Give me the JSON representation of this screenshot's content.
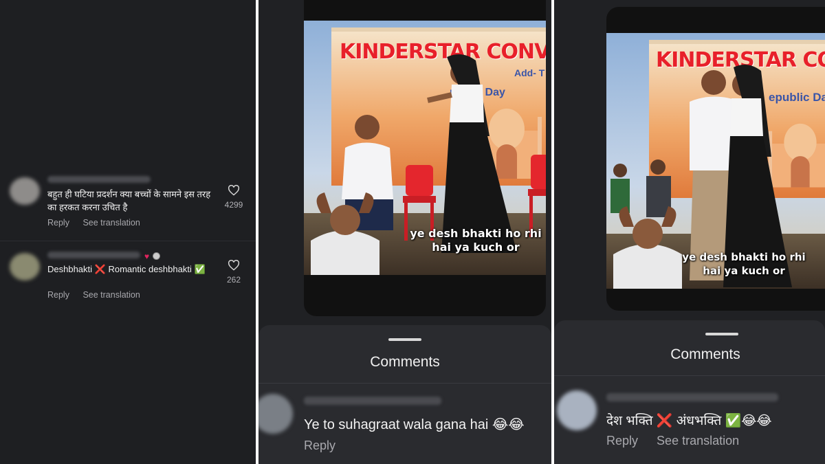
{
  "panel1": {
    "comments": [
      {
        "text": "बहुत ही घटिया प्रदर्शन क्या बच्चों के सामने इस तरह का हरकत करना उचित है",
        "likes": "4299",
        "reply": "Reply",
        "see_translation": "See translation"
      },
      {
        "text": "Deshbhakti ❌ Romantic deshbhakti ✅",
        "likes": "262",
        "reply": "Reply",
        "see_translation": "See translation",
        "badge_icons": [
          "heart-icon",
          "avatar-icon"
        ]
      }
    ]
  },
  "panel2": {
    "banner_title": "KINDERSTAR CONVENT",
    "banner_sub": "Add- T",
    "banner_sub2": "public Day",
    "caption_line1": "ye desh bhakti ho rhi",
    "caption_line2": "hai ya kuch or",
    "sheet_title": "Comments",
    "comment": {
      "text": "Ye to suhagraat wala gana hai 😂😂",
      "reply": "Reply"
    }
  },
  "panel3": {
    "banner_title": "KINDERSTAR CONV",
    "banner_sub": "epublic Da",
    "caption_line1": "ye desh bhakti ho rhi",
    "caption_line2": "hai ya kuch or",
    "sheet_title": "Comments",
    "comment": {
      "text": "देश भक्ति ❌ अंधभक्ति ✅😂😂",
      "reply": "Reply",
      "see_translation": "See translation"
    }
  },
  "colors": {
    "background": "#1e1f22",
    "sheet": "#2a2b2f",
    "banner_text": "#e8202a",
    "muted_text": "#a8a8ad",
    "heart": "#e0245e"
  }
}
